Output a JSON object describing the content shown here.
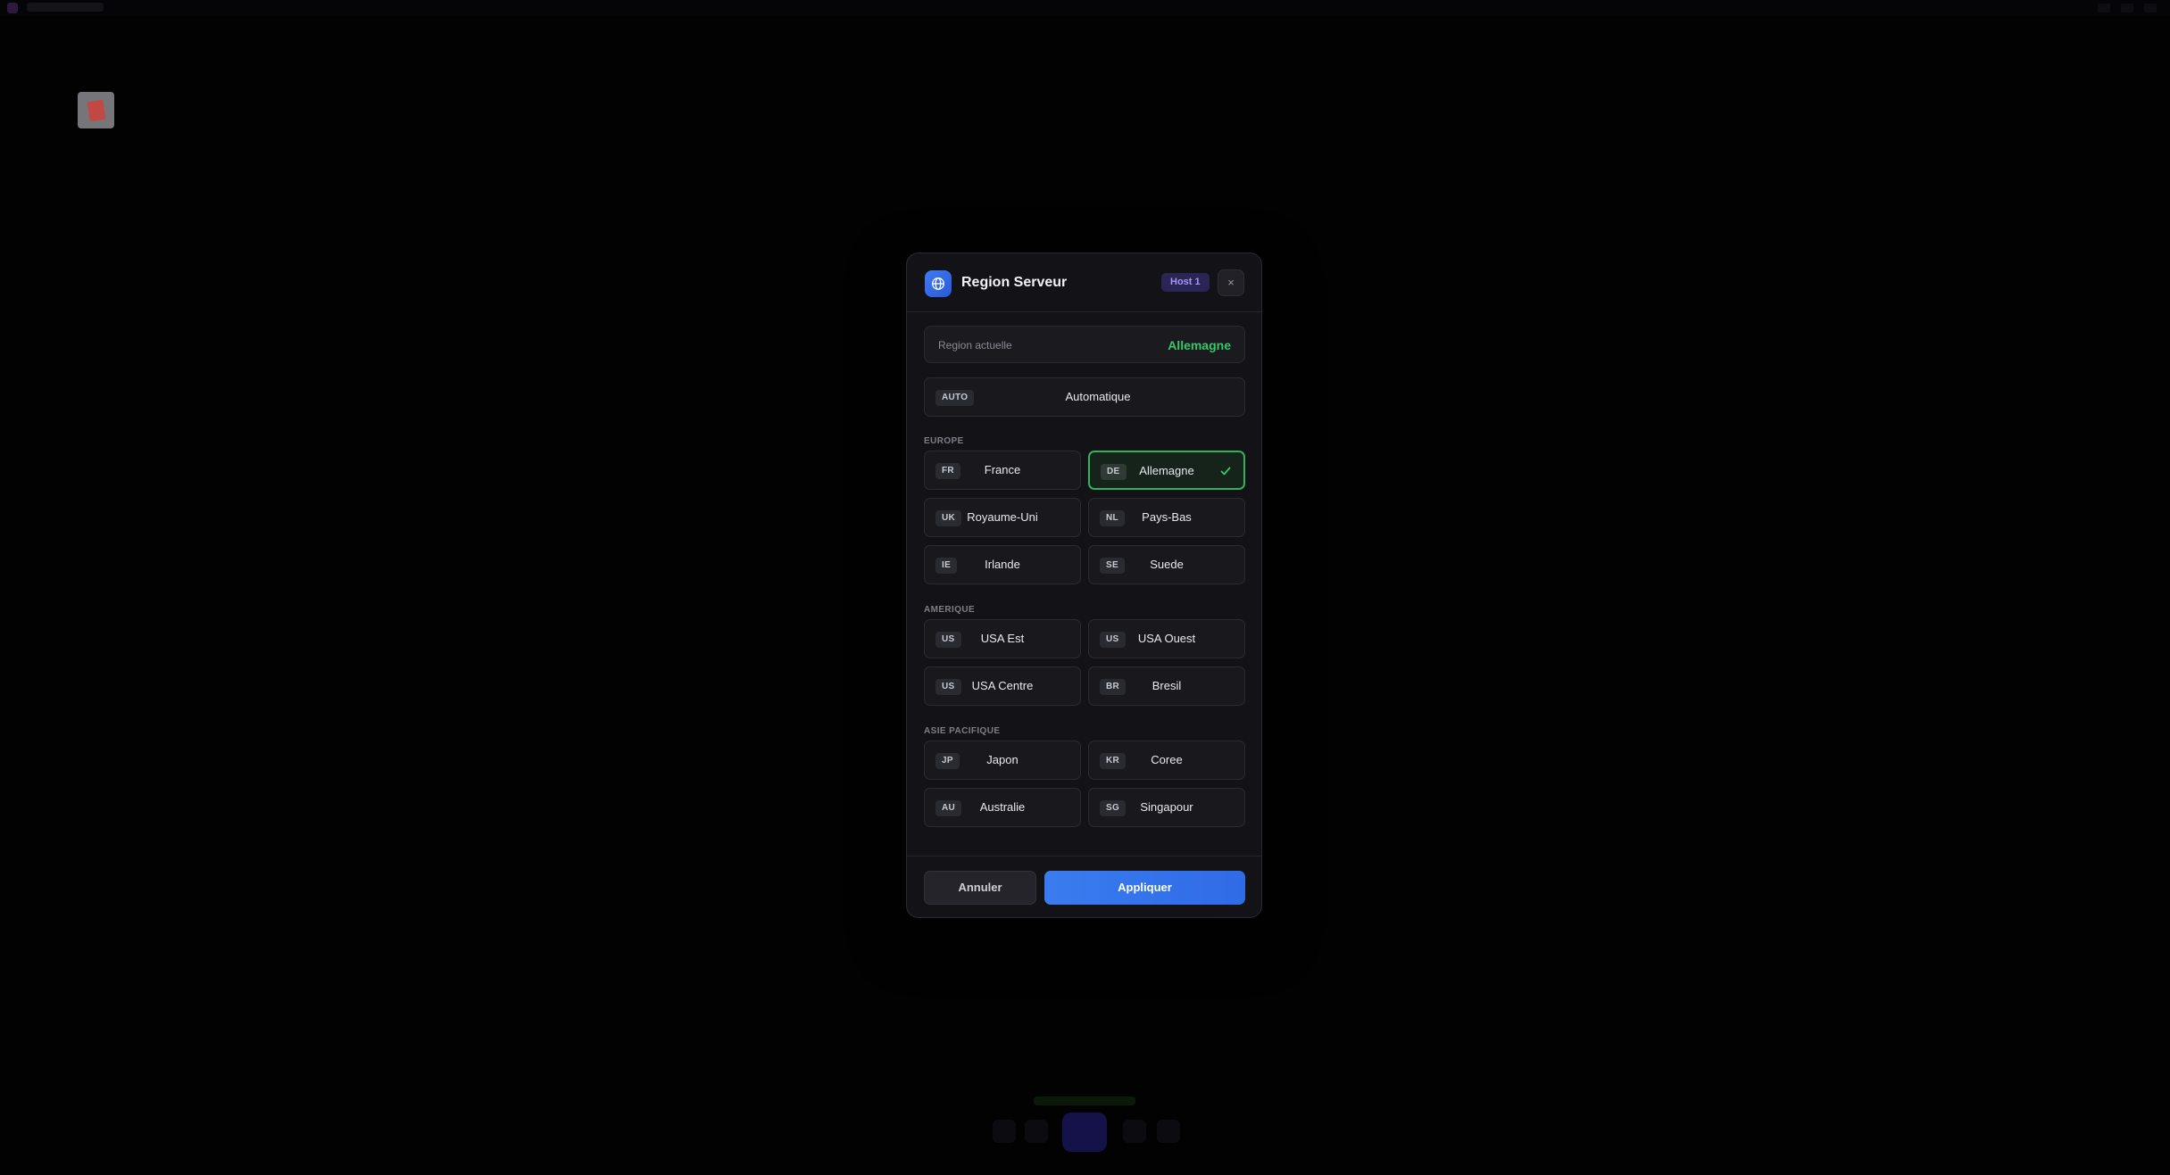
{
  "modal": {
    "title": "Region Serveur",
    "host_badge": "Host 1",
    "close_glyph": "×",
    "current_region": {
      "label": "Region actuelle",
      "value": "Allemagne"
    },
    "auto_option": {
      "code": "AUTO",
      "name": "Automatique"
    },
    "sections": [
      {
        "title": "EUROPE",
        "options": [
          {
            "code": "FR",
            "name": "France"
          },
          {
            "code": "DE",
            "name": "Allemagne"
          },
          {
            "code": "UK",
            "name": "Royaume-Uni"
          },
          {
            "code": "NL",
            "name": "Pays-Bas"
          },
          {
            "code": "IE",
            "name": "Irlande"
          },
          {
            "code": "SE",
            "name": "Suede"
          }
        ]
      },
      {
        "title": "AMERIQUE",
        "options": [
          {
            "code": "US",
            "name": "USA Est"
          },
          {
            "code": "US",
            "name": "USA Ouest"
          },
          {
            "code": "US",
            "name": "USA Centre"
          },
          {
            "code": "BR",
            "name": "Bresil"
          }
        ]
      },
      {
        "title": "ASIE PACIFIQUE",
        "options": [
          {
            "code": "JP",
            "name": "Japon"
          },
          {
            "code": "KR",
            "name": "Coree"
          },
          {
            "code": "AU",
            "name": "Australie"
          },
          {
            "code": "SG",
            "name": "Singapour"
          }
        ]
      }
    ],
    "selected": "Allemagne",
    "footer": {
      "cancel_label": "Annuler",
      "apply_label": "Appliquer"
    }
  },
  "icons": {
    "header": "globe-icon",
    "selected_mark": "check-icon",
    "desktop": "app-icon"
  },
  "colors": {
    "accent_blue": "#3a7cf0",
    "selected_green": "#2fb35c",
    "current_value_green": "#35c76a",
    "badge_purple": "#a497f2"
  }
}
